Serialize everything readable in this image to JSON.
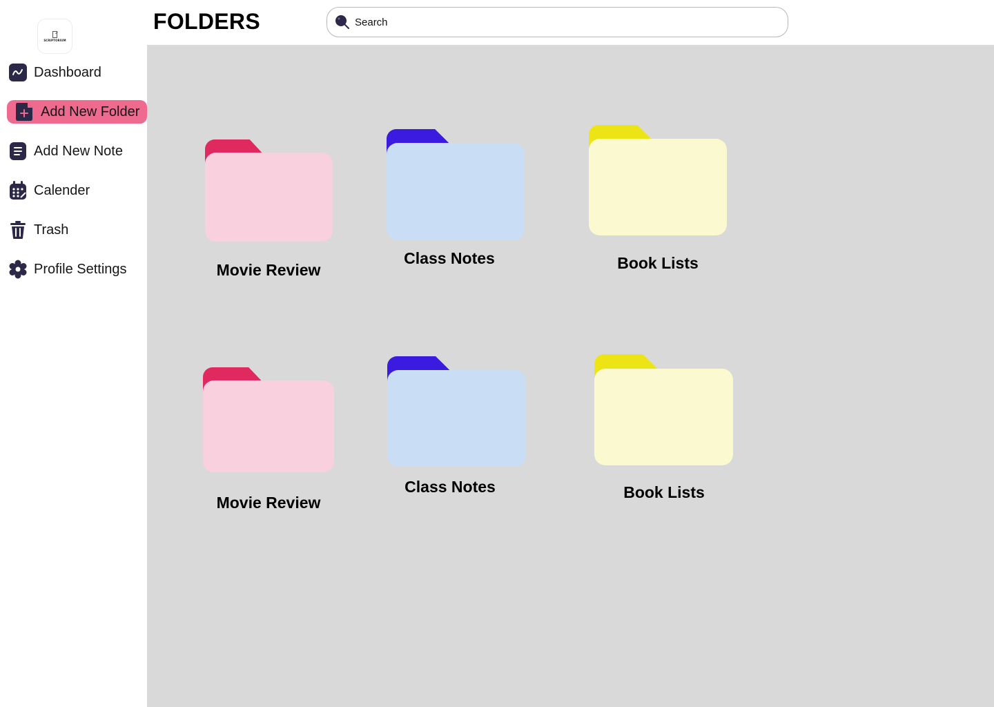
{
  "app": {
    "logo_text": "SCRIPTORIUM",
    "page_title": "FOLDERS"
  },
  "search": {
    "placeholder": "Search"
  },
  "sidebar": {
    "items": [
      {
        "label": "Dashboard",
        "icon": "chart-line-icon",
        "active": false
      },
      {
        "label": "Add New Folder",
        "icon": "add-file-icon",
        "active": true
      },
      {
        "label": "Add New Note",
        "icon": "note-icon",
        "active": false
      },
      {
        "label": "Calender",
        "icon": "calendar-icon",
        "active": false
      },
      {
        "label": "Trash",
        "icon": "trash-icon",
        "active": false
      },
      {
        "label": "Profile Settings",
        "icon": "gear-icon",
        "active": false
      }
    ]
  },
  "folders": [
    {
      "label": "Movie Review",
      "tab_color": "#e02a5f",
      "body_color": "#f8d0de"
    },
    {
      "label": "Class Notes",
      "tab_color": "#3b1be0",
      "body_color": "#c9ddf5"
    },
    {
      "label": "Book Lists",
      "tab_color": "#ece414",
      "body_color": "#fbf9cf"
    },
    {
      "label": "Movie Review",
      "tab_color": "#e02a5f",
      "body_color": "#f8d0de"
    },
    {
      "label": "Class Notes",
      "tab_color": "#3b1be0",
      "body_color": "#c9ddf5"
    },
    {
      "label": "Book Lists",
      "tab_color": "#ece414",
      "body_color": "#fbf9cf"
    }
  ],
  "colors": {
    "icon_dark": "#2b2848",
    "active_bg": "#ee6a8e",
    "main_bg": "#d9d9d9"
  }
}
